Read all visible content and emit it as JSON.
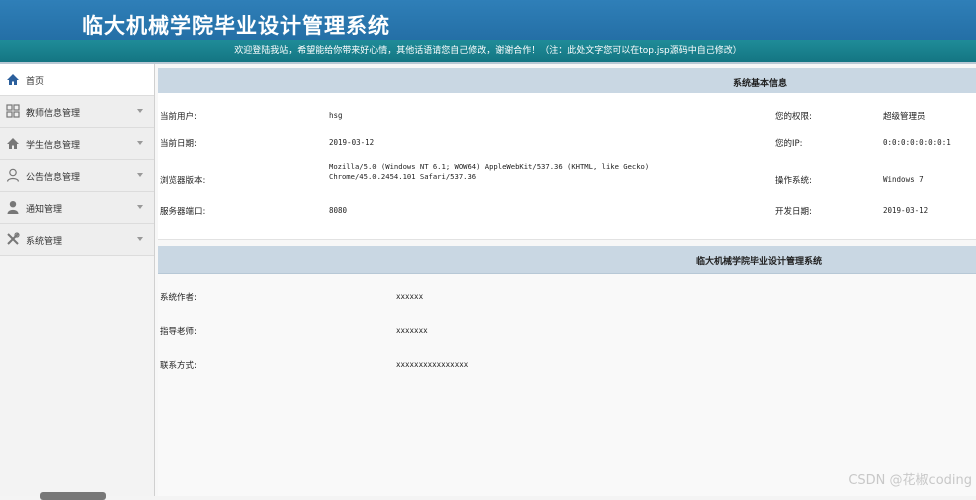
{
  "header": {
    "title": "临大机械学院毕业设计管理系统",
    "welcome": "欢迎登陆我站，希望能给你带来好心情，其他话语请您自己修改，谢谢合作！（注：此处文字您可以在top.jsp源码中自己修改）"
  },
  "sidebar": {
    "items": [
      {
        "label": "首页",
        "icon": "home-icon"
      },
      {
        "label": "教师信息管理",
        "icon": "grid-icon"
      },
      {
        "label": "学生信息管理",
        "icon": "home-icon"
      },
      {
        "label": "公告信息管理",
        "icon": "user-outline-icon"
      },
      {
        "label": "通知管理",
        "icon": "user-icon"
      },
      {
        "label": "系统管理",
        "icon": "tools-icon"
      }
    ]
  },
  "system_info": {
    "title": "系统基本信息",
    "current_user_label": "当前用户:",
    "current_user": "hsg",
    "permission_label": "您的权限:",
    "permission": "超级管理员",
    "current_date_label": "当前日期:",
    "current_date": "2019-03-12",
    "ip_label": "您的IP:",
    "ip": "0:0:0:0:0:0:0:1",
    "browser_label": "浏览器版本:",
    "browser": "Mozilla/5.0 (Windows NT 6.1; WOW64) AppleWebKit/537.36 (KHTML, like Gecko) Chrome/45.0.2454.101 Safari/537.36",
    "os_label": "操作系统:",
    "os": "Windows 7",
    "port_label": "服务器端口:",
    "port": "8080",
    "dev_date_label": "开发日期:",
    "dev_date": "2019-03-12"
  },
  "about": {
    "title": "临大机械学院毕业设计管理系统",
    "author_label": "系统作者:",
    "author": "xxxxxx",
    "advisor_label": "指导老师:",
    "advisor": "xxxxxxx",
    "contact_label": "联系方式:",
    "contact": "xxxxxxxxxxxxxxxx"
  },
  "watermark": "CSDN @花椒coding"
}
